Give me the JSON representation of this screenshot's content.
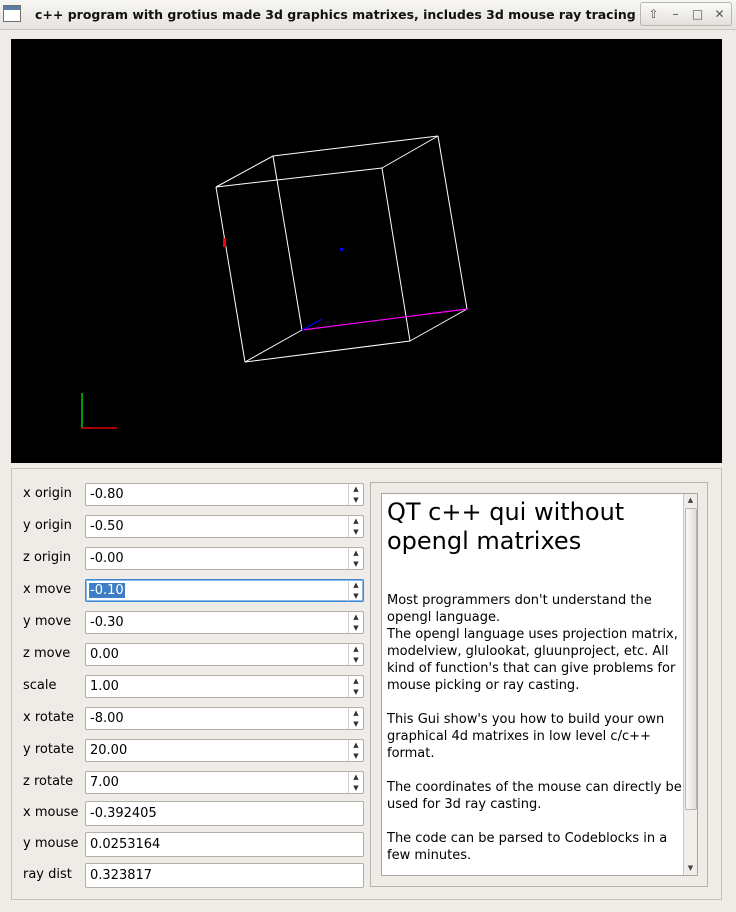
{
  "window": {
    "title": "c++ program with grotius made 3d graphics matrixes, includes 3d mouse ray tracing !!",
    "controls": [
      "⇧",
      "–",
      "□",
      "✕"
    ]
  },
  "colors": {
    "canvas_bg": "#000000",
    "cube_edge": "#ffffff",
    "highlight_edge": "#ff00ff",
    "axis_x": "#ff0000",
    "axis_y": "#00ff00",
    "axis_z": "#0000ff",
    "center_point": "#0000ff",
    "mouse_marker": "#ff0000",
    "selection": "#3e7ec6"
  },
  "spin_fields": [
    {
      "label": "x origin",
      "value": "-0.80"
    },
    {
      "label": "y origin",
      "value": "-0.50"
    },
    {
      "label": "z origin",
      "value": "-0.00"
    },
    {
      "label": "x move",
      "value": "-0.10"
    },
    {
      "label": "y move",
      "value": "-0.30"
    },
    {
      "label": "z move",
      "value": "0.00"
    },
    {
      "label": "scale",
      "value": "1.00"
    },
    {
      "label": "x rotate",
      "value": "-8.00"
    },
    {
      "label": "y rotate",
      "value": "20.00"
    },
    {
      "label": "z rotate",
      "value": "7.00"
    }
  ],
  "text_fields": [
    {
      "label": "x mouse",
      "value": "-0.392405"
    },
    {
      "label": "y mouse",
      "value": "0.0253164"
    },
    {
      "label": "ray dist",
      "value": "0.323817"
    }
  ],
  "info": {
    "heading": "QT c++ qui without opengl matrixes",
    "paragraphs": [
      "Most programmers don't understand the opengl language.\nThe opengl language uses projection matrix, modelview, glulookat, gluunproject, etc. All kind of function's that can give problems for mouse picking or ray casting.",
      "This Gui show's you how to build your own graphical 4d matrixes in low level c/c++ format.",
      "The coordinates of the mouse can directly be used for 3d ray casting.",
      "The code can be parsed to Codeblocks in a few minutes."
    ]
  }
}
